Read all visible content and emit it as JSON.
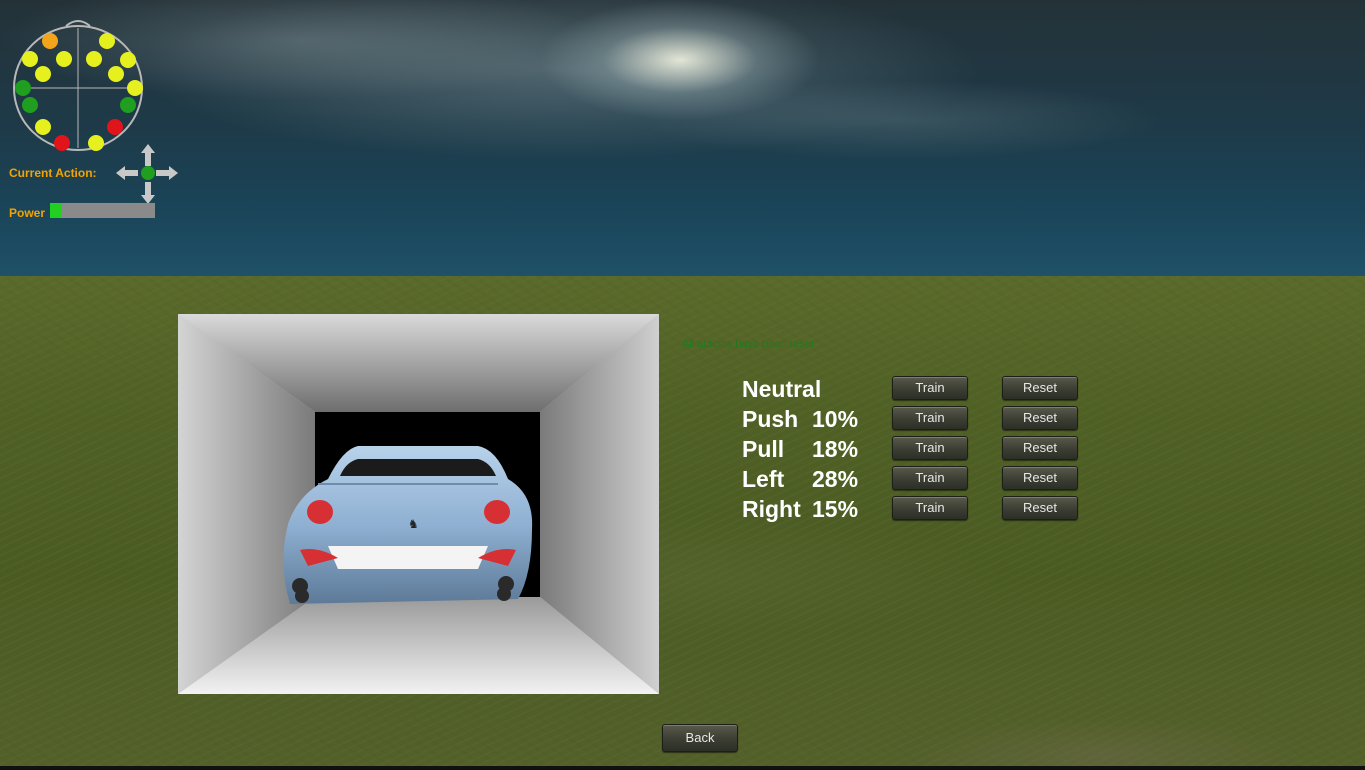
{
  "hud": {
    "current_action_label": "Current Action:",
    "power_label": "Power",
    "power_level": 0.1,
    "sensor_colors": {
      "yellow": "#e6f01e",
      "orange": "#f2a51a",
      "green": "#1f9e1f",
      "red": "#e0141a"
    },
    "direction_indicator_color": "#1f9e1f",
    "icons": [
      "headset-sensor-map-icon",
      "direction-arrows-icon"
    ]
  },
  "status": {
    "message": "All actions have been reset"
  },
  "actions": [
    {
      "name": "Neutral",
      "percent": "",
      "train_label": "Train",
      "reset_label": "Reset"
    },
    {
      "name": "Push",
      "percent": "10%",
      "train_label": "Train",
      "reset_label": "Reset"
    },
    {
      "name": "Pull",
      "percent": "18%",
      "train_label": "Train",
      "reset_label": "Reset"
    },
    {
      "name": "Left",
      "percent": "28%",
      "train_label": "Train",
      "reset_label": "Reset"
    },
    {
      "name": "Right",
      "percent": "15%",
      "train_label": "Train",
      "reset_label": "Reset"
    }
  ],
  "navigation": {
    "back_label": "Back"
  }
}
